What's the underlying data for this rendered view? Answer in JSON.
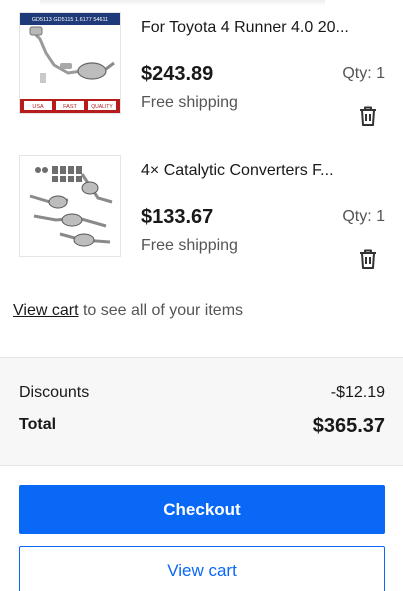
{
  "items": [
    {
      "title": "For Toyota 4 Runner 4.0 20...",
      "price": "$243.89",
      "qty": "Qty: 1",
      "shipping": "Free shipping",
      "image": "exhaust-system-thumbnail",
      "image_text": {
        "top_banner": "GD5113 GD5115 1.6177 54611",
        "badge_1": "USA",
        "badge_2": "FAST",
        "badge_3": "QUALITY"
      }
    },
    {
      "title": "4× Catalytic Converters F...",
      "price": "$133.67",
      "qty": "Qty: 1",
      "shipping": "Free shipping",
      "image": "catalytic-converters-thumbnail"
    }
  ],
  "cart_note": {
    "link": "View cart",
    "text": " to see all of your items"
  },
  "summary": {
    "discounts_label": "Discounts",
    "discounts_value": "-$12.19",
    "total_label": "Total",
    "total_value": "$365.37"
  },
  "buttons": {
    "checkout": "Checkout",
    "view_cart": "View cart"
  },
  "icons": {
    "remove": "trash-icon"
  },
  "colors": {
    "primary": "#0968f6",
    "text": "#191919",
    "secondary_text": "#555555",
    "summary_bg": "#f7f7f7"
  }
}
